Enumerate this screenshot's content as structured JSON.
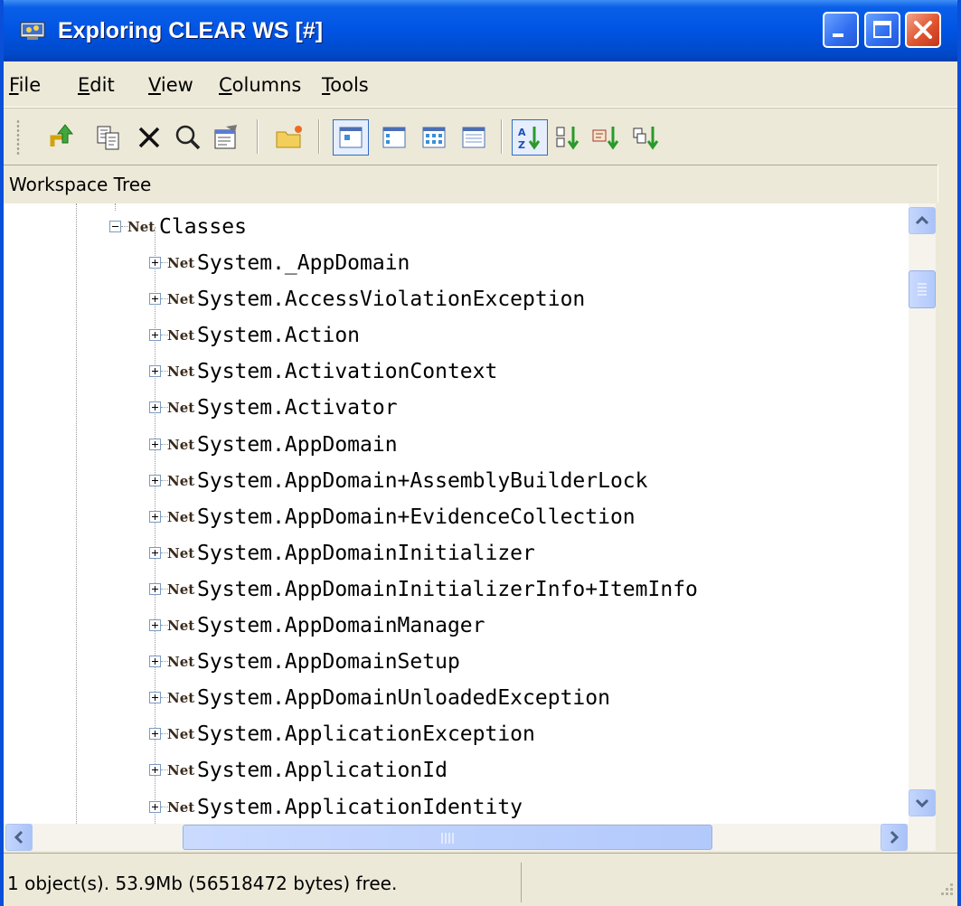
{
  "window": {
    "title": "Exploring CLEAR WS [#]"
  },
  "menu": [
    {
      "label": "File",
      "mnemonic": "F",
      "rest": "ile"
    },
    {
      "label": "Edit",
      "mnemonic": "E",
      "rest": "dit"
    },
    {
      "label": "View",
      "mnemonic": "V",
      "rest": "iew"
    },
    {
      "label": "Columns",
      "mnemonic": "C",
      "rest": "olumns"
    },
    {
      "label": "Tools",
      "mnemonic": "T",
      "rest": "ools"
    }
  ],
  "toolbar": {
    "buttons": [
      {
        "name": "up-folder",
        "icon": "up-arrow-icon"
      },
      {
        "name": "copy",
        "icon": "copy-icon"
      },
      {
        "name": "delete",
        "icon": "delete-x-icon"
      },
      {
        "name": "find",
        "icon": "magnifier-icon"
      },
      {
        "name": "properties",
        "icon": "properties-icon"
      },
      {
        "name": "new-folder",
        "icon": "new-folder-icon"
      },
      {
        "name": "large-icons-view",
        "icon": "large-icons-icon",
        "checked": true
      },
      {
        "name": "small-icons-view",
        "icon": "small-icons-icon"
      },
      {
        "name": "list-view",
        "icon": "list-icon"
      },
      {
        "name": "details-view",
        "icon": "details-icon"
      },
      {
        "name": "sort-by-name",
        "icon": "sort-az-icon",
        "checked": true
      },
      {
        "name": "sort-by-type",
        "icon": "sort-type-icon"
      },
      {
        "name": "sort-by-size",
        "icon": "sort-size-icon"
      },
      {
        "name": "sort-by-date",
        "icon": "sort-date-icon"
      }
    ]
  },
  "panel": {
    "title": "Workspace Tree"
  },
  "tree": {
    "root": {
      "label": "Classes",
      "expanded": true,
      "icon": "net-class-icon",
      "icon_text": "Net"
    },
    "children": [
      "System._AppDomain",
      "System.AccessViolationException",
      "System.Action",
      "System.ActivationContext",
      "System.Activator",
      "System.AppDomain",
      "System.AppDomain+AssemblyBuilderLock",
      "System.AppDomain+EvidenceCollection",
      "System.AppDomainInitializer",
      "System.AppDomainInitializerInfo+ItemInfo",
      "System.AppDomainManager",
      "System.AppDomainSetup",
      "System.AppDomainUnloadedException",
      "System.ApplicationException",
      "System.ApplicationId",
      "System.ApplicationIdentity"
    ]
  },
  "status": {
    "text": "1 object(s). 53.9Mb (56518472 bytes) free."
  }
}
